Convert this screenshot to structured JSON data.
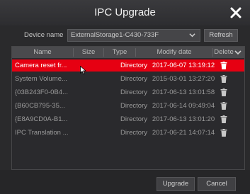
{
  "window": {
    "title": "IPC Upgrade",
    "close_icon": "close-icon"
  },
  "device": {
    "label": "Device name",
    "selected": "ExternalStorage1-C430-733F",
    "refresh_label": "Refresh"
  },
  "table": {
    "headers": {
      "name": "Name",
      "size": "Size",
      "type": "Type",
      "modify_date": "Modify date",
      "delete": "Delete"
    },
    "rows": [
      {
        "name": "Camera reset fr...",
        "size": "",
        "type": "Directory",
        "date": "2017-06-07 13:19:12",
        "selected": true
      },
      {
        "name": "System Volume...",
        "size": "",
        "type": "Directory",
        "date": "2015-03-01 13:27:20",
        "selected": false
      },
      {
        "name": "{03B243F0-0B4...",
        "size": "",
        "type": "Directory",
        "date": "2017-06-13 13:01:58",
        "selected": false
      },
      {
        "name": "{B60CB795-35...",
        "size": "",
        "type": "Directory",
        "date": "2017-06-14 09:49:04",
        "selected": false
      },
      {
        "name": "{E8A9CD0A-B1...",
        "size": "",
        "type": "Directory",
        "date": "2017-06-13 13:01:20",
        "selected": false
      },
      {
        "name": "IPC Translation ...",
        "size": "",
        "type": "Directory",
        "date": "2017-06-21 14:07:14",
        "selected": false
      }
    ]
  },
  "buttons": {
    "upgrade": "Upgrade",
    "cancel": "Cancel"
  },
  "colors": {
    "selection": "#e60012",
    "background": "#2a2a2c"
  }
}
